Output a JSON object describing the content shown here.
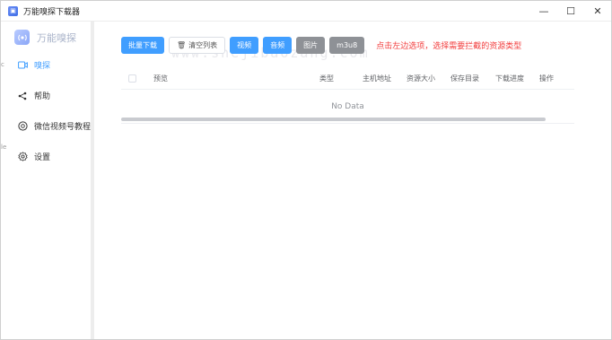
{
  "window": {
    "title": "万能嗅探下载器",
    "controls": {
      "minimize": "—",
      "maximize": "☐",
      "close": "✕"
    }
  },
  "sidebar": {
    "brand": "万能嗅探",
    "items": [
      {
        "label": "嗅探",
        "icon": "video-icon",
        "active": true
      },
      {
        "label": "帮助",
        "icon": "share-icon",
        "active": false
      },
      {
        "label": "微信视频号教程",
        "icon": "wechat-icon",
        "active": false
      },
      {
        "label": "设置",
        "icon": "gear-icon",
        "active": false
      }
    ],
    "edge_glyphs": [
      "c",
      "le"
    ]
  },
  "toolbar": {
    "batch_download": "批量下载",
    "clear_list": "清空列表",
    "filters": [
      "视频",
      "音频",
      "图片",
      "m3u8"
    ],
    "hint": "点击左边选项，选择需要拦截的资源类型"
  },
  "watermark": "www.shejibaozang.com",
  "table": {
    "columns": [
      "预览",
      "类型",
      "主机地址",
      "资源大小",
      "保存目录",
      "下载进度",
      "操作"
    ],
    "empty_text": "No Data"
  },
  "colors": {
    "primary": "#409eff",
    "hint": "#f23c3c",
    "gray_button": "#8e9196"
  }
}
